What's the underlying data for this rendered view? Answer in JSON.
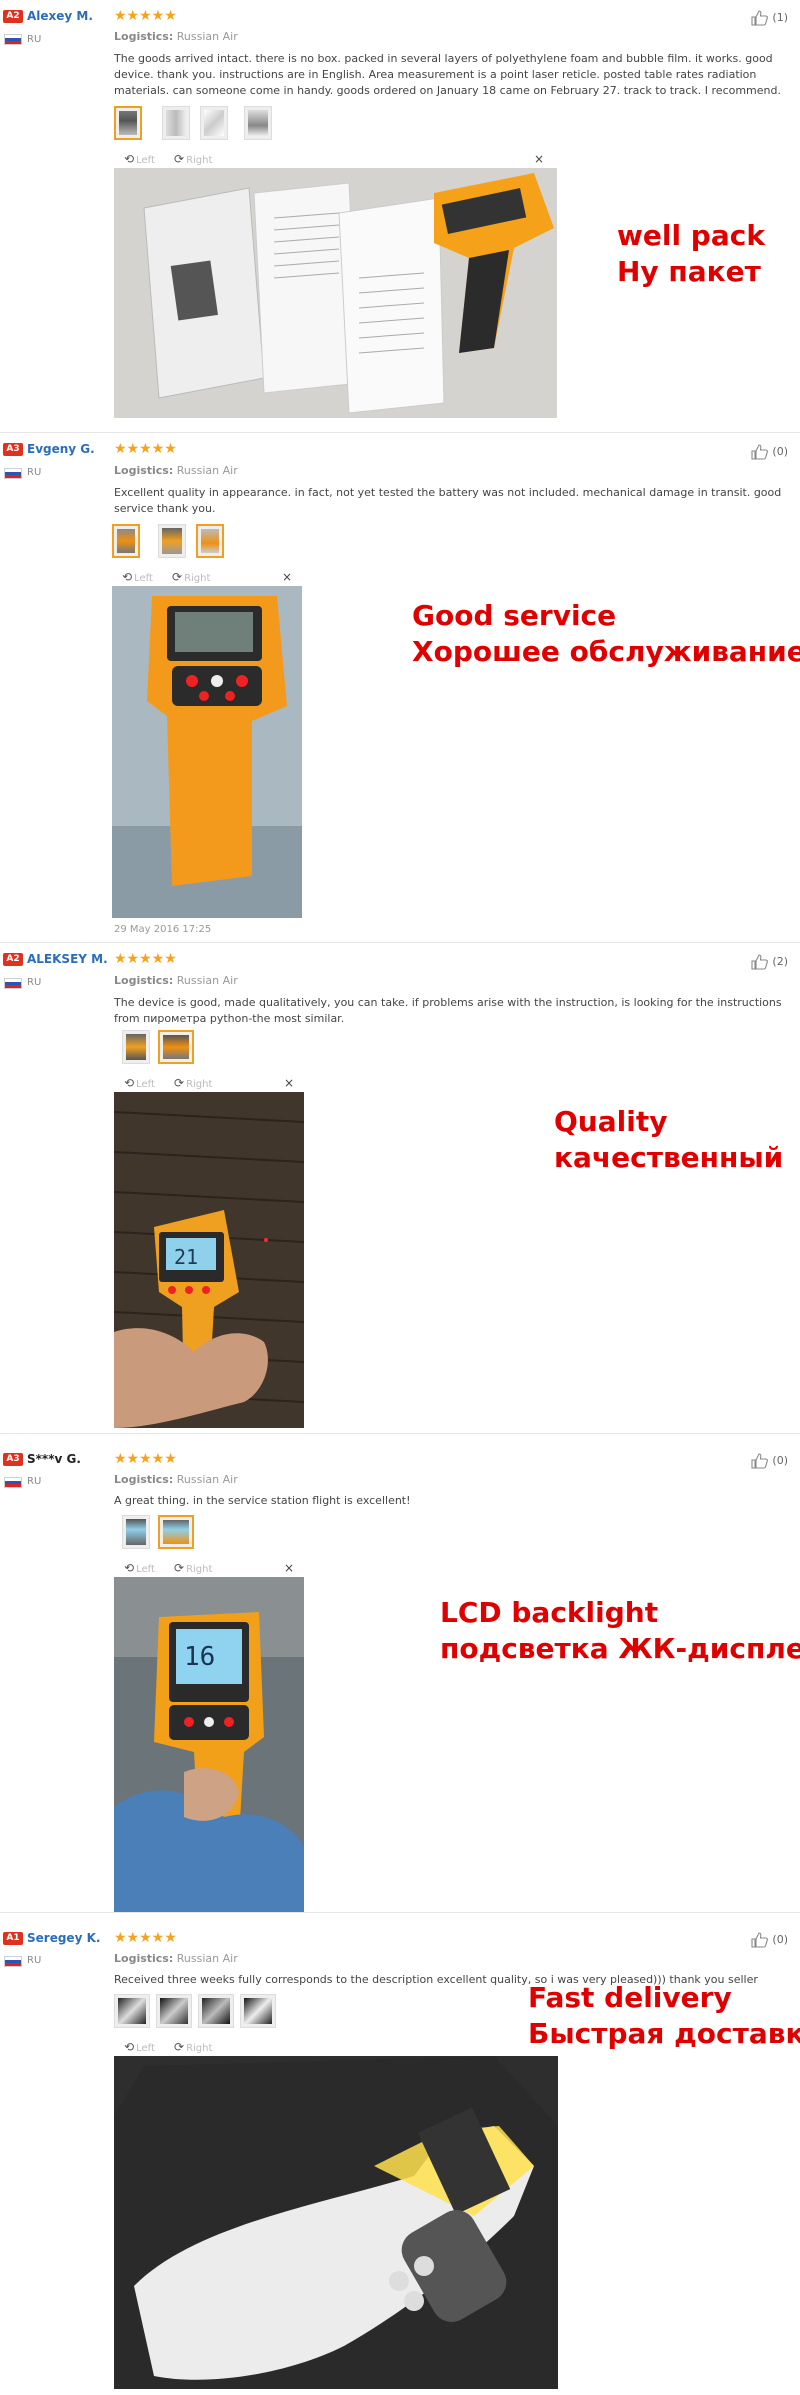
{
  "reviews": [
    {
      "badge": "A2",
      "name": "Alexey M.",
      "country": "RU",
      "stars": "★★★★★",
      "logistics_label": "Logistics:",
      "logistics_value": "Russian Air",
      "text": "The goods arrived intact. there is no box. packed in several layers of polyethylene foam and bubble film. it works. good device. thank you. instructions are in English. Area measurement is a point laser reticle. posted table rates radiation materials. can someone come in handy. goods ordered on January 18 came on February 27. track to track. I recommend.",
      "likes": "(1)",
      "caption1": "well pack",
      "caption2": "Ну пакет"
    },
    {
      "badge": "A3",
      "name": "Evgeny G.",
      "country": "RU",
      "stars": "★★★★★",
      "logistics_label": "Logistics:",
      "logistics_value": "Russian Air",
      "text": "Excellent quality in appearance. in fact, not yet tested the battery was not included. mechanical damage in transit. good service thank you.",
      "likes": "(0)",
      "date": "29 May 2016 17:25",
      "caption1": "Good service",
      "caption2": "Хорошее обслуживание"
    },
    {
      "badge": "A2",
      "name": "ALEKSEY M.",
      "country": "RU",
      "stars": "★★★★★",
      "logistics_label": "Logistics:",
      "logistics_value": "Russian Air",
      "text": "The device is good, made qualitatively, you can take. if problems arise with the instruction, is looking for the instructions from пирометра python-the most similar.",
      "likes": "(2)",
      "caption1": "Quality",
      "caption2": "качественный"
    },
    {
      "badge": "A3",
      "name": "S***v G.",
      "country": "RU",
      "stars": "★★★★★",
      "logistics_label": "Logistics:",
      "logistics_value": "Russian Air",
      "text": "A great thing. in the service station flight is excellent!",
      "likes": "(0)",
      "caption1": "LCD backlight",
      "caption2": "подсветка ЖК-дисплея"
    },
    {
      "badge": "A1",
      "name": "Seregey K.",
      "country": "RU",
      "stars": "★★★★★",
      "logistics_label": "Logistics:",
      "logistics_value": "Russian Air",
      "text": "Received three weeks fully corresponds to the description excellent quality, so i was very pleased))) thank you seller",
      "likes": "(0)",
      "caption1": "Fast delivery",
      "caption2": "Быстрая доставка"
    }
  ],
  "viewer": {
    "left_label": "Left",
    "right_label": "Right",
    "close_label": "×"
  },
  "colors": {
    "caption": "#e00000",
    "stars": "#f7a21b",
    "name": "#2a6ebb",
    "badge": "#e0301e",
    "thumb_selected": "#f0a020"
  }
}
